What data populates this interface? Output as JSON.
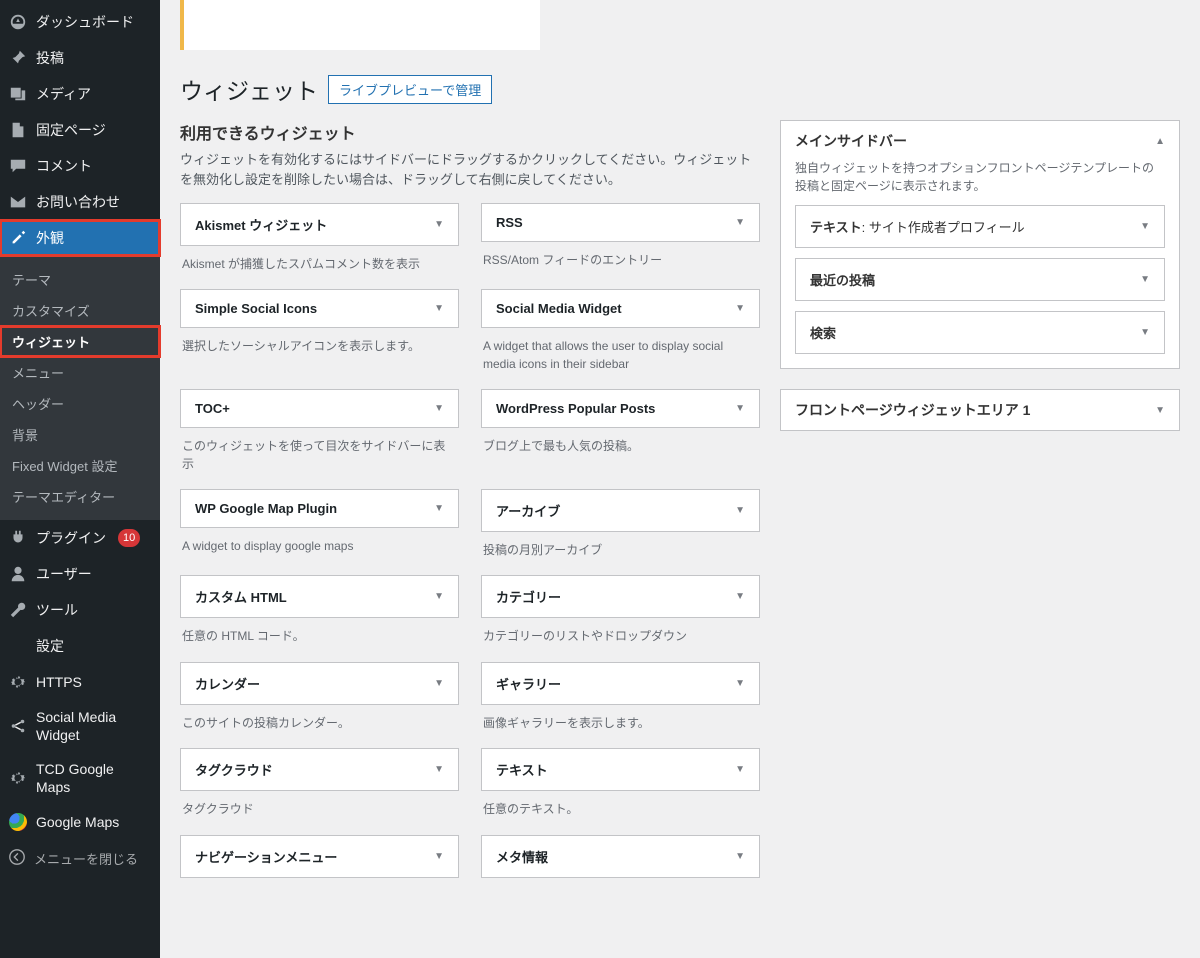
{
  "sidebar": {
    "dashboard": "ダッシュボード",
    "posts": "投稿",
    "media": "メディア",
    "pages": "固定ページ",
    "comments": "コメント",
    "contact": "お問い合わせ",
    "appearance": "外観",
    "appearance_sub": {
      "themes": "テーマ",
      "customize": "カスタマイズ",
      "widgets": "ウィジェット",
      "menus": "メニュー",
      "header": "ヘッダー",
      "background": "背景",
      "fixed_widget": "Fixed Widget 設定",
      "theme_editor": "テーマエディター"
    },
    "plugins": "プラグイン",
    "plugins_count": "10",
    "users": "ユーザー",
    "tools": "ツール",
    "settings": "設定",
    "https": "HTTPS",
    "smw": "Social Media Widget",
    "tcd_maps": "TCD Google Maps",
    "google_maps": "Google Maps",
    "collapse": "メニューを閉じる"
  },
  "header": {
    "title": "ウィジェット",
    "live_preview": "ライブプレビューで管理"
  },
  "available": {
    "title": "利用できるウィジェット",
    "desc": "ウィジェットを有効化するにはサイドバーにドラッグするかクリックしてください。ウィジェットを無効化し設定を削除したい場合は、ドラッグして右側に戻してください。"
  },
  "widgets": [
    [
      {
        "title": "Akismet ウィジェット",
        "desc": "Akismet が捕獲したスパムコメント数を表示"
      },
      {
        "title": "RSS",
        "desc": "RSS/Atom フィードのエントリー"
      }
    ],
    [
      {
        "title": "Simple Social Icons",
        "desc": "選択したソーシャルアイコンを表示します。"
      },
      {
        "title": "Social Media Widget",
        "desc": "A widget that allows the user to display social media icons in their sidebar"
      }
    ],
    [
      {
        "title": "TOC+",
        "desc": "このウィジェットを使って目次をサイドバーに表示"
      },
      {
        "title": "WordPress Popular Posts",
        "desc": "ブログ上で最も人気の投稿。"
      }
    ],
    [
      {
        "title": "WP Google Map Plugin",
        "desc": "A widget to display google maps"
      },
      {
        "title": "アーカイブ",
        "desc": "投稿の月別アーカイブ"
      }
    ],
    [
      {
        "title": "カスタム HTML",
        "desc": "任意の HTML コード。"
      },
      {
        "title": "カテゴリー",
        "desc": "カテゴリーのリストやドロップダウン"
      }
    ],
    [
      {
        "title": "カレンダー",
        "desc": "このサイトの投稿カレンダー。"
      },
      {
        "title": "ギャラリー",
        "desc": "画像ギャラリーを表示します。"
      }
    ],
    [
      {
        "title": "タグクラウド",
        "desc": "タグクラウド"
      },
      {
        "title": "テキスト",
        "desc": "任意のテキスト。"
      }
    ],
    [
      {
        "title": "ナビゲーションメニュー",
        "desc": ""
      },
      {
        "title": "メタ情報",
        "desc": ""
      }
    ]
  ],
  "sidebars": {
    "main": {
      "title": "メインサイドバー",
      "desc": "独自ウィジェットを持つオプションフロントページテンプレートの投稿と固定ページに表示されます。",
      "items": [
        {
          "label_prefix": "テキスト",
          "label_suffix": ": サイト作成者プロフィール"
        },
        {
          "label_prefix": "最近の投稿",
          "label_suffix": ""
        },
        {
          "label_prefix": "検索",
          "label_suffix": ""
        }
      ]
    },
    "front": {
      "title": "フロントページウィジェットエリア 1"
    }
  }
}
